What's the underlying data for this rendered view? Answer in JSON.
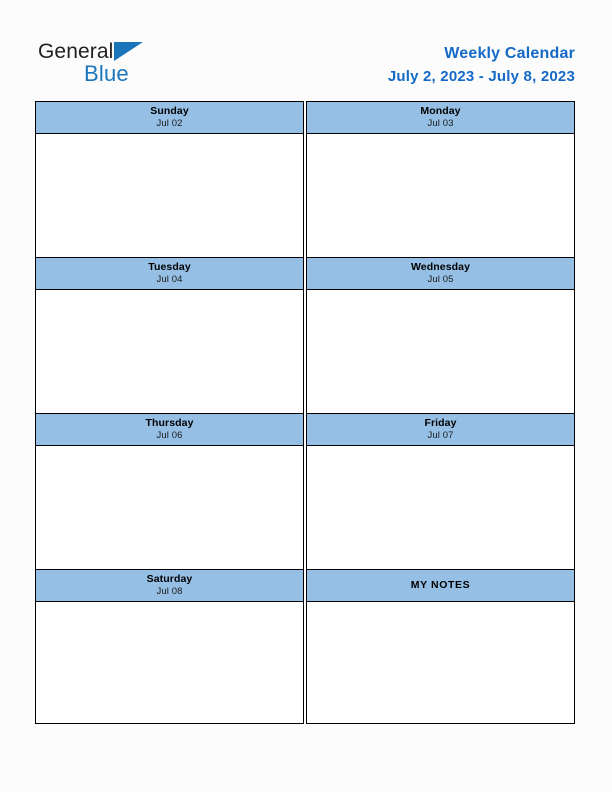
{
  "brand": {
    "name_part_1": "General",
    "name_part_2": "Blue",
    "logo_icon": "blue-triangle-icon",
    "primary_color": "#1b75bb",
    "text_color": "#231f20"
  },
  "header": {
    "title": "Weekly Calendar",
    "date_range": "July 2, 2023 - July 8, 2023",
    "title_color": "#1569c7"
  },
  "calendar": {
    "header_background": "#95bfe4",
    "border_color": "#000000",
    "body_background": "#ffffff",
    "rows": [
      {
        "left": {
          "day": "Sunday",
          "date": "Jul 02",
          "content": ""
        },
        "right": {
          "day": "Monday",
          "date": "Jul 03",
          "content": ""
        }
      },
      {
        "left": {
          "day": "Tuesday",
          "date": "Jul 04",
          "content": ""
        },
        "right": {
          "day": "Wednesday",
          "date": "Jul 05",
          "content": ""
        }
      },
      {
        "left": {
          "day": "Thursday",
          "date": "Jul 06",
          "content": ""
        },
        "right": {
          "day": "Friday",
          "date": "Jul 07",
          "content": ""
        }
      },
      {
        "left": {
          "day": "Saturday",
          "date": "Jul 08",
          "content": ""
        },
        "right": {
          "day": "MY NOTES",
          "date": "",
          "content": ""
        }
      }
    ]
  },
  "page": {
    "background": "#fcfcfc"
  }
}
